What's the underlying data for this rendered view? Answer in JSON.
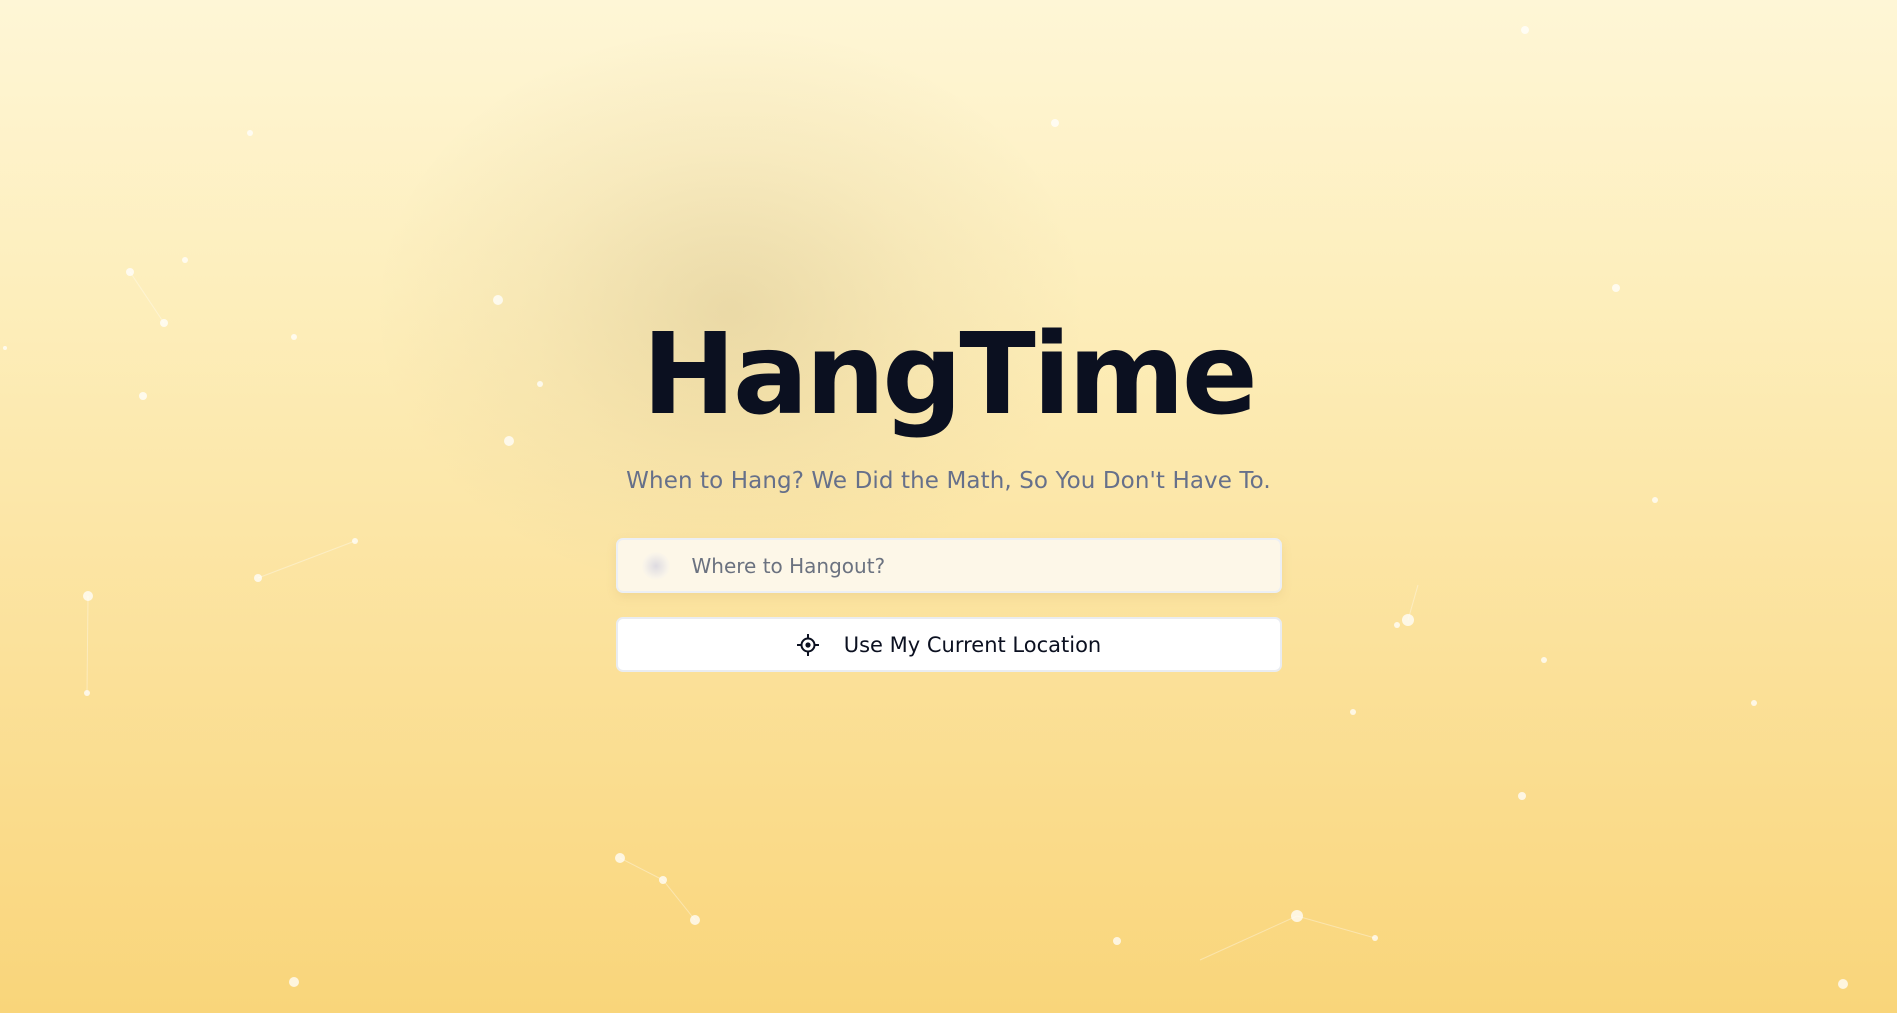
{
  "app": {
    "title": "HangTime",
    "tagline": "When to Hang? We Did the Math, So You Don't Have To."
  },
  "search": {
    "placeholder": "Where to Hangout?",
    "value": "",
    "icon": "search-icon"
  },
  "location_button": {
    "label": "Use My Current Location",
    "icon": "crosshair-icon"
  },
  "colors": {
    "title": "#0b1020",
    "subtitle": "#66708a",
    "background_top": "#fef6d6",
    "background_bottom": "#f9d57a",
    "button_bg": "#ffffff"
  }
}
